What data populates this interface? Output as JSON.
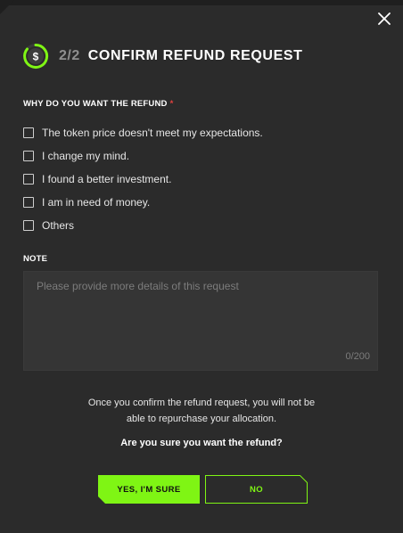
{
  "header": {
    "step": "2/2",
    "title": "CONFIRM REFUND REQUEST"
  },
  "reasons": {
    "label": "WHY DO YOU WANT THE REFUND",
    "required_mark": "*",
    "options": [
      {
        "label": "The token price doesn't meet my expectations.",
        "checked": false
      },
      {
        "label": "I change my mind.",
        "checked": false
      },
      {
        "label": "I found a better investment.",
        "checked": false
      },
      {
        "label": "I am in need of money.",
        "checked": false
      },
      {
        "label": "Others",
        "checked": false
      }
    ]
  },
  "note": {
    "label": "NOTE",
    "placeholder": "Please provide more details of this request",
    "value": "",
    "counter": "0/200"
  },
  "confirmation": {
    "message_line1": "Once you confirm the refund request, you will not be",
    "message_line2": "able to repurchase your allocation.",
    "question": "Are you sure you want the refund?"
  },
  "buttons": {
    "yes_label": "YES, I'M SURE",
    "no_label": "NO"
  },
  "colors": {
    "accent": "#7ff514",
    "background": "#2b2b2b",
    "required": "#e0413f"
  },
  "icons": {
    "close": "close-icon",
    "step": "dollar-progress-icon"
  }
}
